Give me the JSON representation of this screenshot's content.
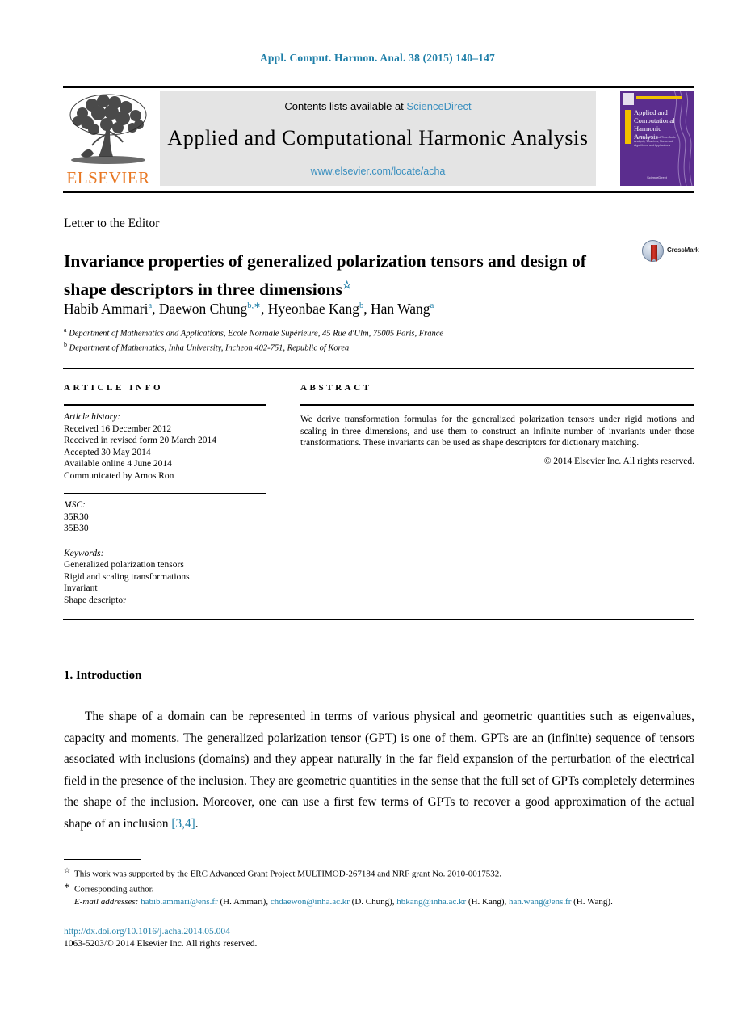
{
  "running_head": "Appl. Comput. Harmon. Anal. 38 (2015) 140–147",
  "masthead": {
    "publisher_wordmark": "ELSEVIER",
    "contents_prefix": "Contents lists available at",
    "contents_link": "ScienceDirect",
    "journal_title": "Applied and Computational Harmonic Analysis",
    "journal_url": "www.elsevier.com/locate/acha",
    "cover": {
      "title_line1": "Applied and",
      "title_line2": "Computational",
      "title_line3": "Harmonic Analysis",
      "subtitle": "Time-Frequency and Time-Scale Analysis, Wavelets, Numerical Algorithms, and Applications",
      "footer": "ScienceDirect"
    }
  },
  "article": {
    "section_type": "Letter to the Editor",
    "title": "Invariance properties of generalized polarization tensors and design of shape descriptors in three dimensions",
    "title_footnote_marker": "☆",
    "crossmark_label": "CrossMark",
    "authors": [
      {
        "name": "Habib Ammari",
        "marks": "a"
      },
      {
        "name": "Daewon Chung",
        "marks": "b,∗"
      },
      {
        "name": "Hyeonbae Kang",
        "marks": "b"
      },
      {
        "name": "Han Wang",
        "marks": "a"
      }
    ],
    "affiliations": [
      {
        "marker": "a",
        "text": "Department of Mathematics and Applications, Ecole Normale Supérieure, 45 Rue d'Ulm, 75005 Paris, France"
      },
      {
        "marker": "b",
        "text": "Department of Mathematics, Inha University, Incheon 402-751, Republic of Korea"
      }
    ]
  },
  "info": {
    "kicker": "ARTICLE INFO",
    "history_head": "Article history:",
    "history": [
      "Received 16 December 2012",
      "Received in revised form 20 March 2014",
      "Accepted 30 May 2014",
      "Available online 4 June 2014",
      "Communicated by Amos Ron"
    ],
    "msc_head": "MSC:",
    "msc": [
      "35R30",
      "35B30"
    ],
    "keywords_head": "Keywords:",
    "keywords": [
      "Generalized polarization tensors",
      "Rigid and scaling transformations",
      "Invariant",
      "Shape descriptor"
    ]
  },
  "abstract": {
    "kicker": "ABSTRACT",
    "text": "We derive transformation formulas for the generalized polarization tensors under rigid motions and scaling in three dimensions, and use them to construct an infinite number of invariants under those transformations. These invariants can be used as shape descriptors for dictionary matching.",
    "copyright": "© 2014 Elsevier Inc. All rights reserved."
  },
  "body": {
    "section_number_title": "1. Introduction",
    "paragraph_part1": "The shape of a domain can be represented in terms of various physical and geometric quantities such as eigenvalues, capacity and moments. The generalized polarization tensor (GPT) is one of them. GPTs are an (infinite) sequence of tensors associated with inclusions (domains) and they appear naturally in the far field expansion of the perturbation of the electrical field in the presence of the inclusion. They are geometric quantities in the sense that the full set of GPTs completely determines the shape of the inclusion. Moreover, one can use a first few terms of GPTs to recover a good approximation of the actual shape of an inclusion ",
    "citation": "[3,4]",
    "paragraph_part2": "."
  },
  "footnotes": {
    "funding_marker": "☆",
    "funding": "This work was supported by the ERC Advanced Grant Project MULTIMOD-267184 and NRF grant No. 2010-0017532.",
    "corresponding_marker": "∗",
    "corresponding": "Corresponding author.",
    "email_label": "E-mail addresses:",
    "emails": [
      {
        "address": "habib.ammari@ens.fr",
        "owner": "(H. Ammari),"
      },
      {
        "address": "chdaewon@inha.ac.kr",
        "owner": "(D. Chung),"
      },
      {
        "address": "hbkang@inha.ac.kr",
        "owner": "(H. Kang),"
      },
      {
        "address": "han.wang@ens.fr",
        "owner": "(H. Wang)."
      }
    ]
  },
  "footer": {
    "doi": "http://dx.doi.org/10.1016/j.acha.2014.05.004",
    "issn_line": "1063-5203/© 2014 Elsevier Inc. All rights reserved."
  },
  "colors": {
    "link_blue": "#1f7fa8",
    "sciencedirect_blue": "#3a8fbf",
    "elsevier_orange": "#E87722",
    "cover_purple": "#5b2d8e",
    "cover_yellow": "#f2c200"
  }
}
